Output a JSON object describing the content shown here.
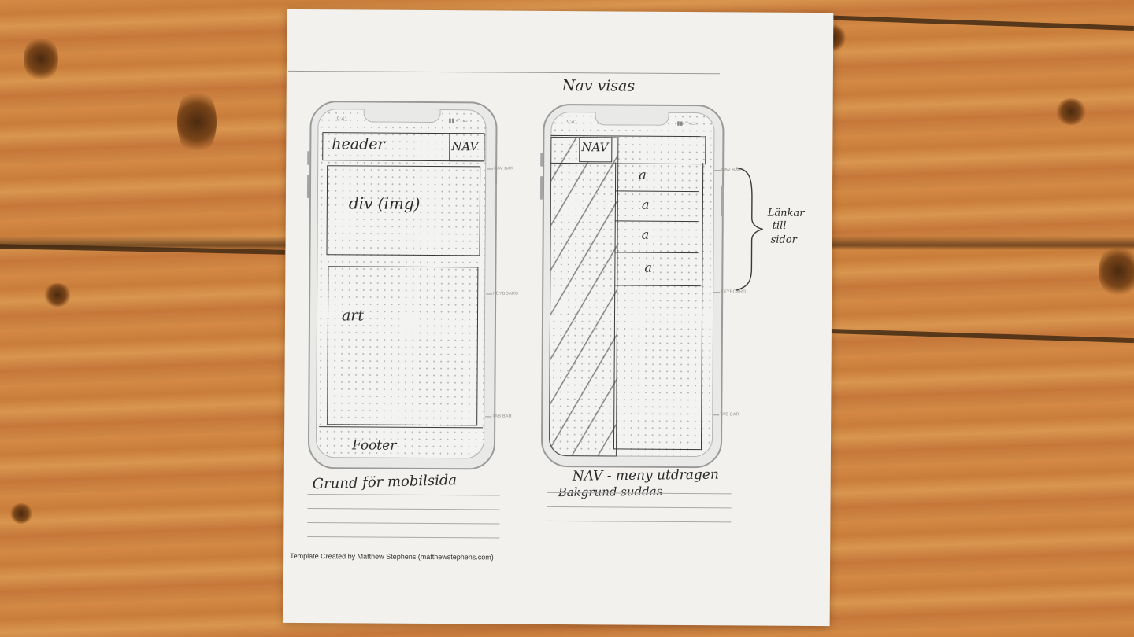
{
  "sheet": {
    "page_heading": "Nav visas",
    "credit": "Template Created by Matthew Stephens (matthewstephens.com)"
  },
  "left_phone": {
    "status_time": "9:41",
    "labels": {
      "header": "header",
      "nav": "NAV",
      "div_img": "div (img)",
      "art": "art",
      "footer": "Footer"
    },
    "ticks": {
      "nav_bar": "NAV BAR",
      "keyboard": "KEYBOARD",
      "tab_bar": "TAB BAR"
    },
    "caption": "Grund för mobilsida"
  },
  "right_phone": {
    "status_time": "9:41",
    "labels": {
      "nav": "NAV",
      "links": [
        "a",
        "a",
        "a",
        "a"
      ],
      "brace_note": [
        "Länkar",
        "till",
        "sidor"
      ]
    },
    "ticks": {
      "nav_bar": "NAV BAR",
      "keyboard": "KEYBOARD",
      "tab_bar": "TAB BAR"
    },
    "caption_line1": "NAV - meny utdragen",
    "caption_line2": "Bakgrund suddas"
  }
}
